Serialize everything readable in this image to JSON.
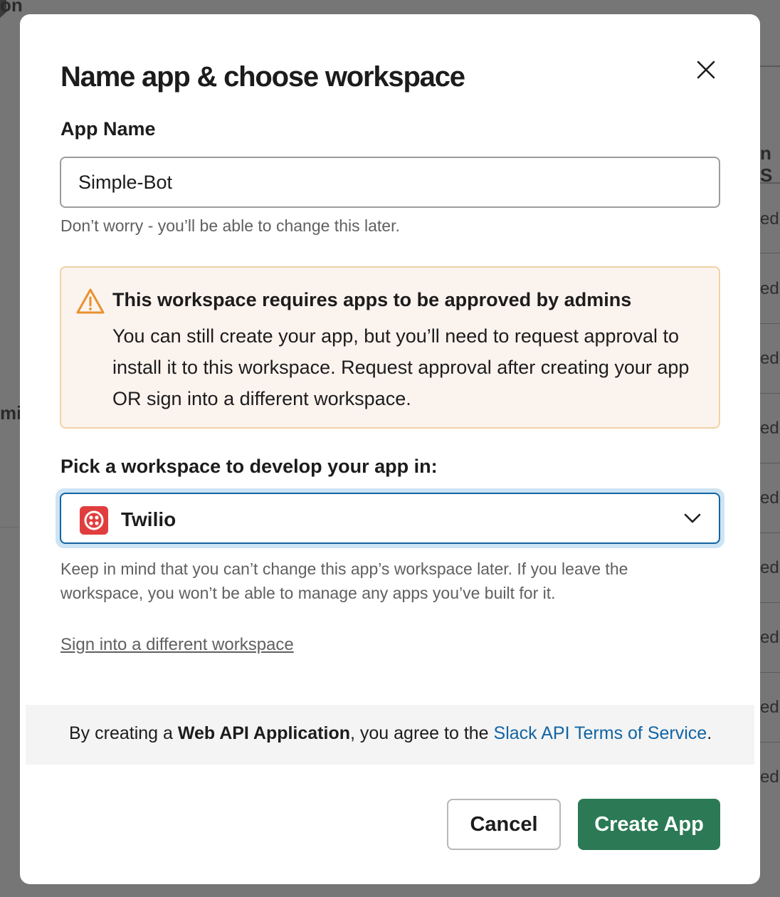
{
  "background": {
    "top_left_fragment": "on",
    "mid_left_fragment": "mi",
    "right_header_fragment": "n S",
    "right_row_fragments": [
      "ed",
      "ed",
      "ed",
      "ed",
      "ed",
      "ed",
      "ed",
      "ed",
      "ed"
    ]
  },
  "modal": {
    "title": "Name app & choose workspace",
    "close_icon": "close-icon",
    "app_name": {
      "label": "App Name",
      "value": "Simple-Bot",
      "hint": "Don’t worry - you’ll be able to change this later."
    },
    "warning": {
      "icon": "warning-triangle-icon",
      "title": "This workspace requires apps to be approved by admins",
      "body": "You can still create your app, but you’ll need to request approval to install it to this workspace. Request approval after creating your app OR sign into a different workspace."
    },
    "workspace": {
      "label": "Pick a workspace to develop your app in:",
      "selected": "Twilio",
      "logo_icon": "twilio-logo-icon",
      "hint": "Keep in mind that you can’t change this app’s workspace later. If you leave the workspace, you won’t be able to manage any apps you’ve built for it."
    },
    "sign_in_link": "Sign into a different workspace",
    "terms": {
      "prefix": "By creating a ",
      "app_type": "Web API Application",
      "middle": ", you agree to the ",
      "link": "Slack API Terms of Service",
      "suffix": "."
    },
    "buttons": {
      "cancel": "Cancel",
      "create": "Create App"
    }
  },
  "colors": {
    "primary_button": "#2b7a55",
    "link": "#1264a3",
    "warning_bg": "#fbf3ee",
    "warning_border": "#f0d3a6",
    "warning_icon": "#e8912d",
    "select_focus": "#1264a3",
    "twilio_red": "#e03e3e"
  }
}
